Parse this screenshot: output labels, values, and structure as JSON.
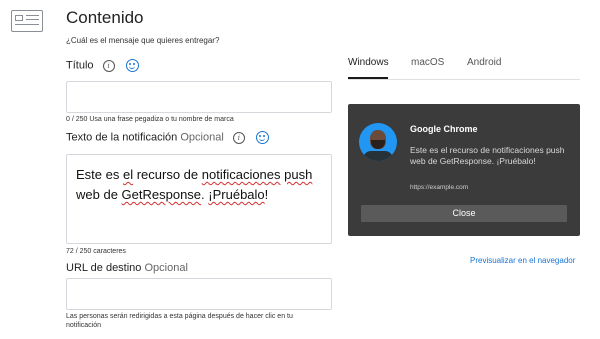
{
  "page": {
    "title": "Contenido",
    "subtitle": "¿Cuál es el mensaje que quieres entregar?"
  },
  "title_field": {
    "label": "Título",
    "value": "",
    "hint": "0 / 250 Usa una frase pegadiza o tu nombre de marca"
  },
  "notification_field": {
    "label": "Texto de la notificación",
    "optional": "Opcional",
    "value_parts": [
      "Este es ",
      "el",
      " recurso de ",
      "notificaciones",
      " ",
      "push",
      " web de ",
      "GetResponse",
      ". ",
      "¡Pruébalo",
      "!"
    ],
    "hint": "72 / 250 caracteres"
  },
  "url_field": {
    "label": "URL de destino",
    "optional": "Opcional",
    "value": "",
    "hint_line1": "Las personas serán redirigidas a esta página después de hacer clic en tu",
    "hint_line2": "notificación"
  },
  "tabs": [
    {
      "label": "Windows",
      "active": true
    },
    {
      "label": "macOS",
      "active": false
    },
    {
      "label": "Android",
      "active": false
    }
  ],
  "preview": {
    "app": "Google Chrome",
    "message": "Este es el recurso de notificaciones push web de GetResponse. ¡Pruébalo!",
    "url": "https://example.com",
    "close_label": "Close"
  },
  "preview_link": "Previsualizar en el navegador",
  "icons": {
    "content": "content-block-icon",
    "info": "info-icon",
    "emoji": "emoji-icon"
  },
  "colors": {
    "accent": "#1976d2",
    "spellcheck": "#d32f2f",
    "preview_bg": "#3b3b3b"
  }
}
